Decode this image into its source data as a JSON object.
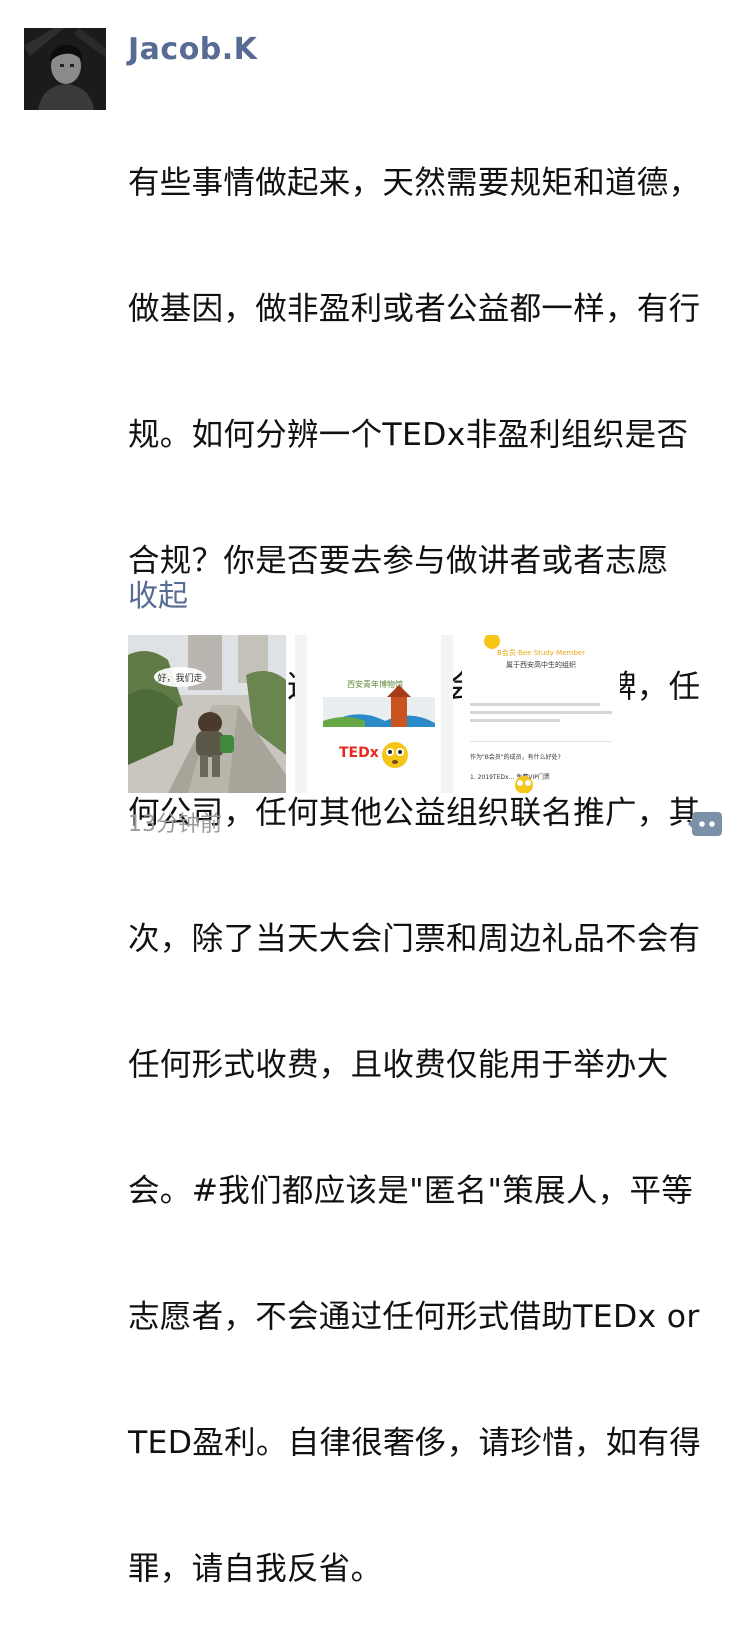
{
  "post": {
    "author": "Jacob.K",
    "lines": [
      "有些事情做起来，天然需要规矩和道德，",
      "做基因，做非盈利或者公益都一样，有行",
      "规。如何分辨一个TEDx非盈利组织是否",
      "合规？你是否要去参与做讲者或者志愿",
      "者？首先，这个组织不会跟任何品牌，任",
      "何公司，任何其他公益组织联名推广，其",
      "次，除了当天大会门票和周边礼品不会有",
      "任何形式收费，且收费仅能用于举办大",
      "会。#我们都应该是\"匿名\"策展人，平等",
      "志愿者，不会通过任何形式借助TEDx or",
      "TED盈利。自律很奢侈，请珍惜，如有得",
      "罪，请自我反省。"
    ],
    "collapse_label": "收起",
    "time": "13分钟前"
  },
  "images": {
    "photo_caption": "好，我们走",
    "poster_brand": "西安青年博物馆",
    "tedx_logo": "TEDx",
    "tedx_logo_suffix": "",
    "doc_header": "B会员·Bee Study Member",
    "doc_subheader": "属于西安高中生的组织",
    "doc_question": "作为\"B会员\"的成员，有什么好处?",
    "doc_item1": "1. 2019TEDx… 免费VIP门票"
  },
  "colors": {
    "link": "#576b95",
    "text": "#111111",
    "timestamp": "#9b9b9b",
    "ted_red": "#e62b1e"
  }
}
